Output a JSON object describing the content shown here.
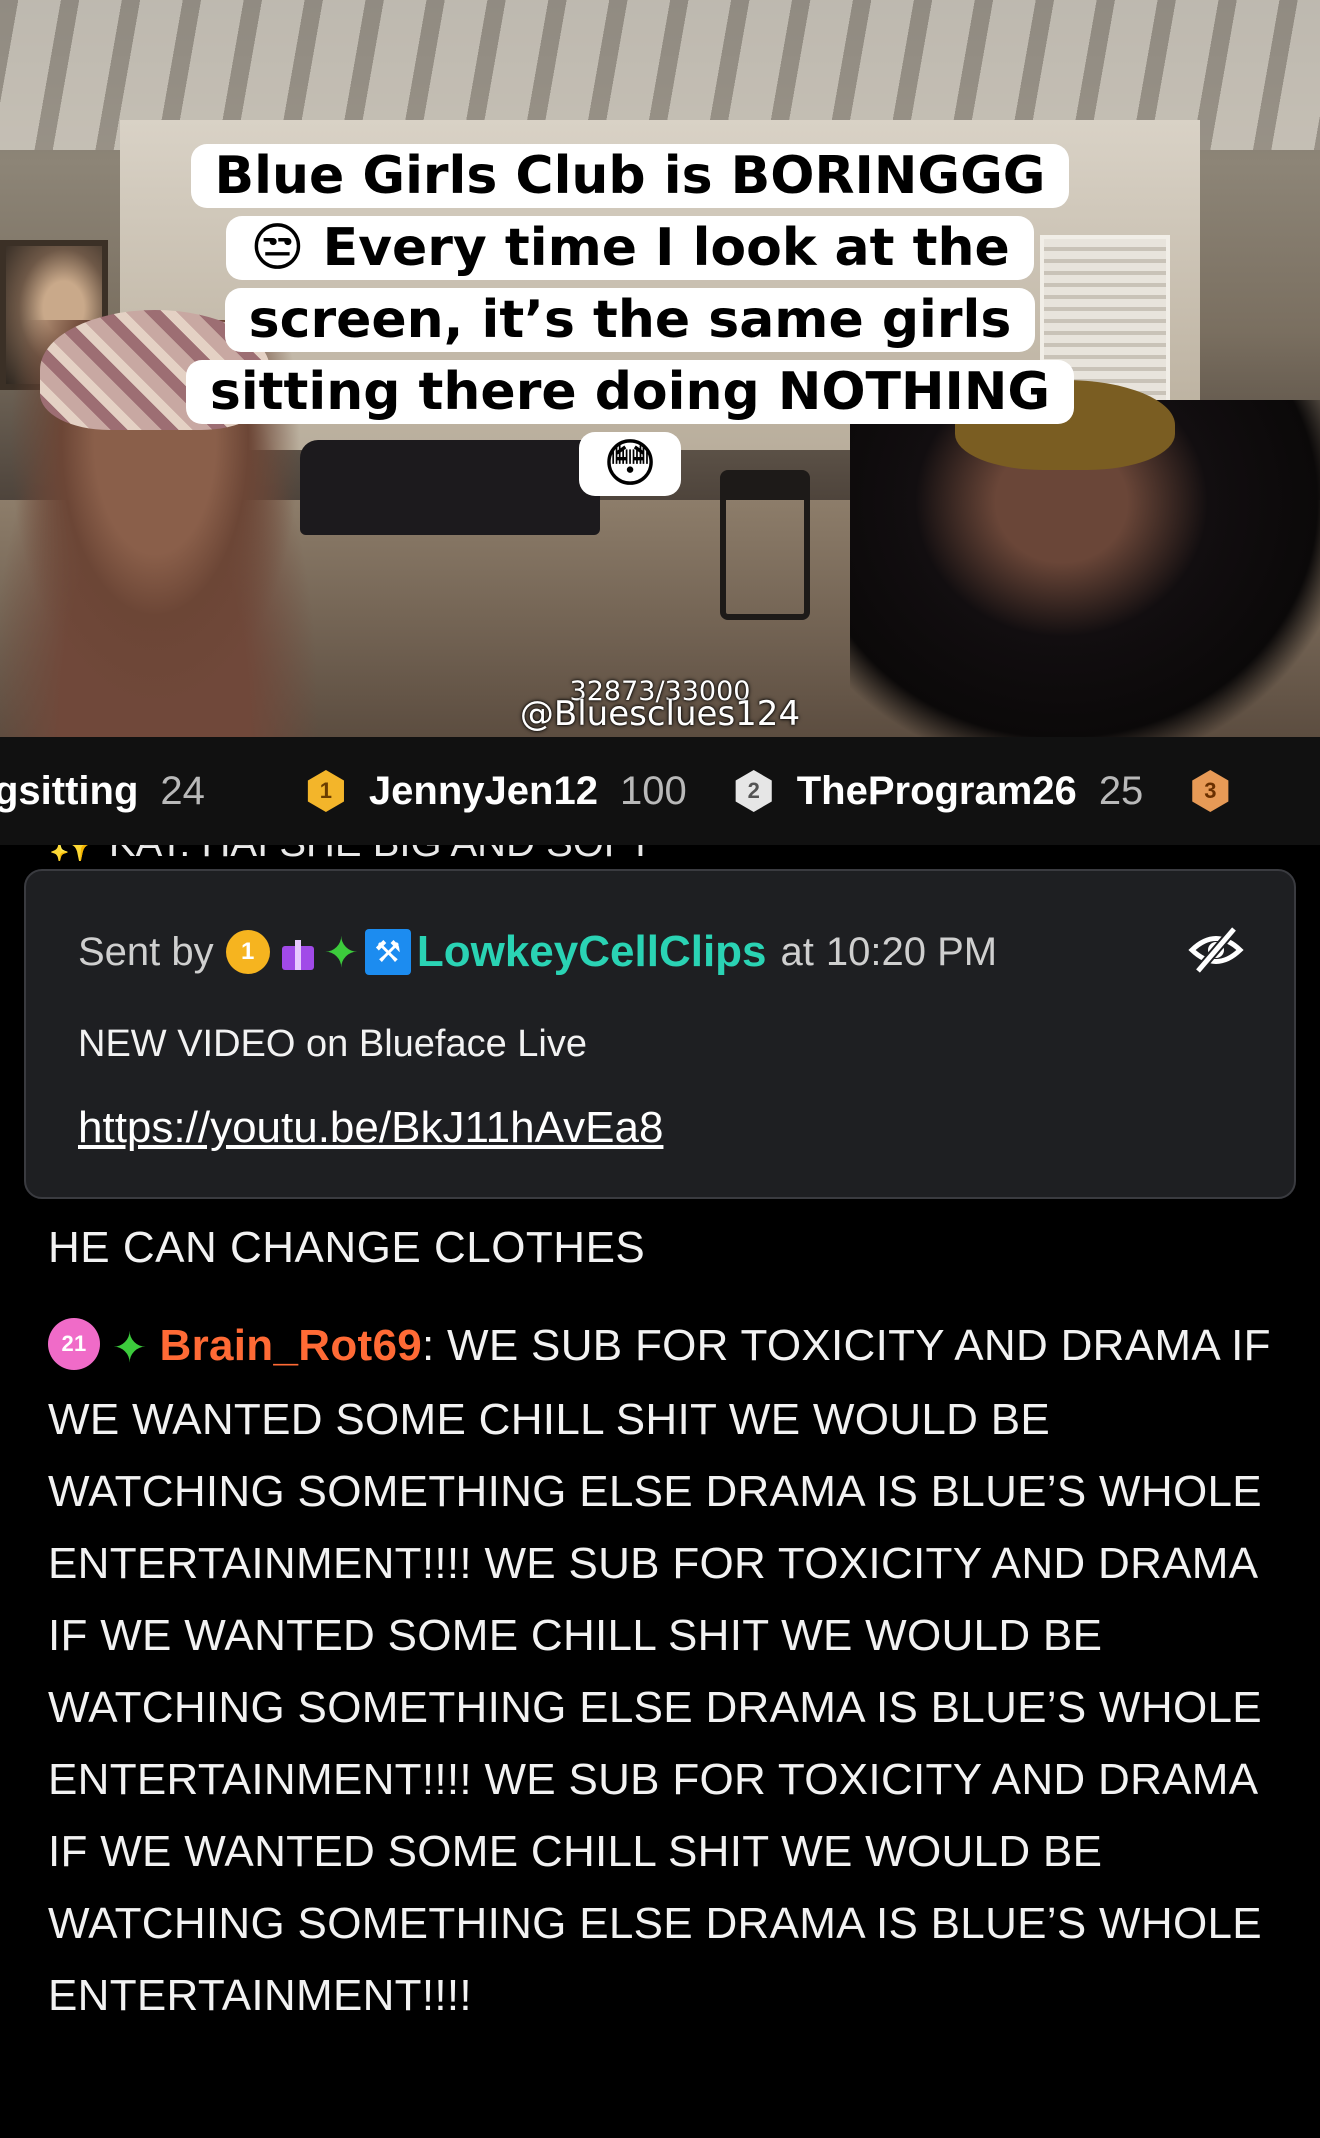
{
  "video": {
    "caption_lines": [
      "Blue Girls Club is BORINGGG",
      "😒 Every time I look at the",
      "screen, it’s the same girls",
      "sitting there doing NOTHING",
      "😳"
    ],
    "view_counter": "32873/33000",
    "watermark": "@Bluesclues124"
  },
  "leaderboard": {
    "entries": [
      {
        "rank": "",
        "name": "gsitting",
        "score": "24"
      },
      {
        "rank": "1",
        "name": "JennyJen12",
        "score": "100"
      },
      {
        "rank": "2",
        "name": "TheProgram26",
        "score": "25"
      },
      {
        "rank": "3",
        "name": "",
        "score": ""
      }
    ]
  },
  "chat": {
    "cutoff_text": "✨ KAT: HAI SHE BIG AND SOFT",
    "pinned": {
      "sent_by_label": "Sent by",
      "badge_level": "1",
      "username": "LowkeyCellClips",
      "at_label": "at",
      "time": "10:20 PM",
      "body": "NEW VIDEO on Blueface Live",
      "link": "https://youtu.be/BkJ11hAvEa8"
    },
    "plain_message": "HE CAN CHANGE CLOTHES",
    "long_message": {
      "badge": "21",
      "username": "Brain_Rot69",
      "text": ": WE SUB FOR TOXICITY AND DRAMA IF WE WANTED SOME CHILL SHIT WE WOULD BE WATCHING SOMETHING ELSE DRAMA IS BLUE’S WHOLE ENTERTAINMENT!!!! WE SUB FOR TOXICITY AND DRAMA IF WE WANTED SOME CHILL SHIT WE WOULD BE WATCHING SOMETHING ELSE DRAMA IS BLUE’S WHOLE ENTERTAINMENT!!!! WE SUB FOR TOXICITY AND DRAMA IF WE WANTED SOME CHILL SHIT WE WOULD BE WATCHING SOMETHING ELSE DRAMA IS BLUE’S WHOLE ENTERTAINMENT!!!!"
    }
  },
  "colors": {
    "pinned_username": "#2ad3b4",
    "chat_username": "#ff6a35",
    "gold_badge": "#f3b52a",
    "silver_badge": "#e6e6e6",
    "bronze_badge": "#e79a56",
    "sub_badge": "#f06bc8"
  },
  "icons": [
    "gold-medal-icon",
    "silver-medal-icon",
    "bronze-medal-icon",
    "gift-icon",
    "sparkle-icon",
    "moderator-hammer-icon",
    "eye-off-icon",
    "subscriber-badge-icon"
  ]
}
